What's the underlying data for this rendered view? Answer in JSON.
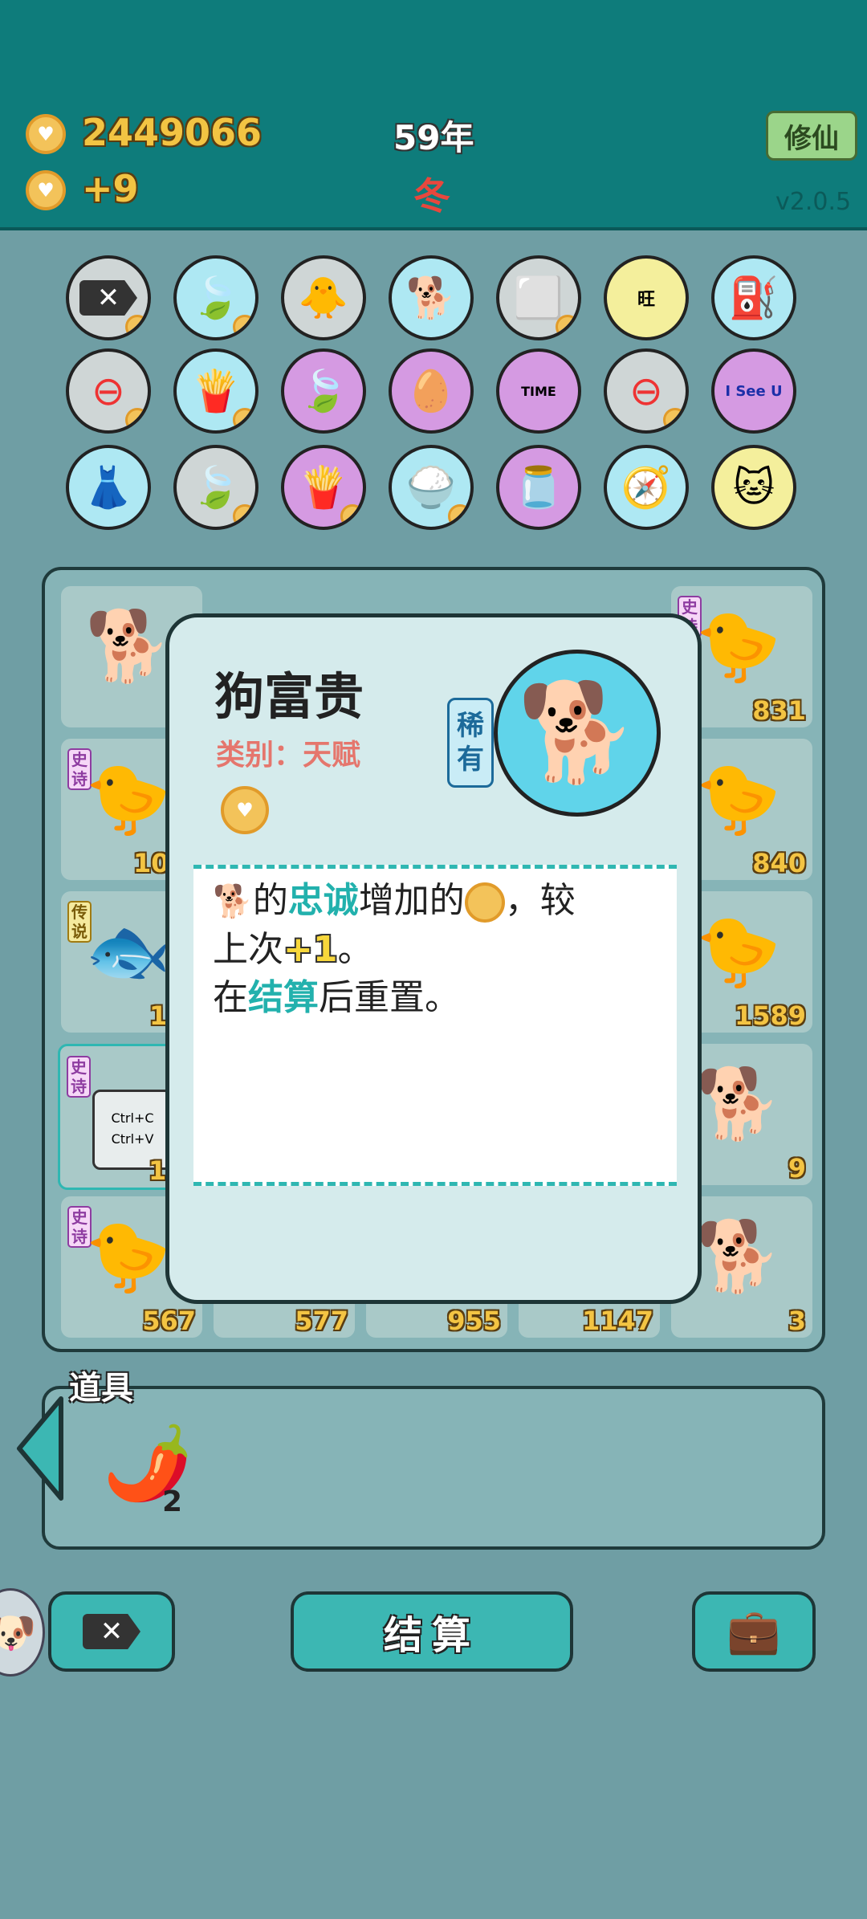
{
  "header": {
    "coins": "2449066",
    "income": "+9",
    "year": "59年",
    "season": "冬",
    "cultivate_label": "修仙",
    "version": "v2.0.5"
  },
  "symbol_icons": [
    [
      "remove-tag-icon",
      "leaf-icon",
      "chick-egg-icon",
      "dog-sunglasses-icon",
      "sugar-cubes-icon",
      "wang-text-icon",
      "pump-icon"
    ],
    [
      "minus-circle-icon",
      "fries-icon",
      "leaf-icon",
      "egg-face-icon",
      "time-magazine-icon",
      "minus-circle-icon",
      "i-see-u-icon"
    ],
    [
      "skirt-icon",
      "leaf-icon",
      "fries-icon",
      "rice-bowl-icon",
      "jar-icon",
      "compass-icon",
      "cat-coins-icon"
    ]
  ],
  "symbol_grid": {
    "wang_char": "旺",
    "time_text": "TIME",
    "isee_text": "I See U"
  },
  "board": {
    "cells": [
      {
        "row": 0,
        "col": 0,
        "value": "",
        "tag": ""
      },
      {
        "row": 0,
        "col": 4,
        "value": "831",
        "tag": "史诗"
      },
      {
        "row": 1,
        "col": 0,
        "value": "10",
        "tag": "史诗"
      },
      {
        "row": 1,
        "col": 4,
        "value": "840",
        "tag": ""
      },
      {
        "row": 2,
        "col": 0,
        "value": "11",
        "tag": "传说"
      },
      {
        "row": 2,
        "col": 4,
        "value": "1589",
        "tag": ""
      },
      {
        "row": 3,
        "col": 0,
        "value": "11",
        "tag": "史诗"
      },
      {
        "row": 3,
        "col": 4,
        "value": "9",
        "tag": ""
      },
      {
        "row": 4,
        "col": 0,
        "value": "567",
        "tag": "史诗"
      },
      {
        "row": 4,
        "col": 1,
        "value": "577",
        "tag": ""
      },
      {
        "row": 4,
        "col": 2,
        "value": "955",
        "tag": ""
      },
      {
        "row": 4,
        "col": 3,
        "value": "1147",
        "tag": ""
      },
      {
        "row": 4,
        "col": 4,
        "value": "3",
        "tag": ""
      }
    ],
    "copy_paste_line1": "Ctrl+C",
    "copy_paste_line2": "Ctrl+V"
  },
  "card": {
    "title": "狗富贵",
    "category": "类别：天赋",
    "rarity_line1": "稀",
    "rarity_line2": "有",
    "desc_part1": "的",
    "desc_kw1": "忠诚",
    "desc_part2": "增加的",
    "desc_part3": "，较",
    "desc_part4": "上次",
    "desc_plus": "+1",
    "desc_part5": "。",
    "desc_part6": "在",
    "desc_kw2": "结算",
    "desc_part7": "后重置。"
  },
  "props": {
    "label": "道具",
    "item_icon": "chili-pepper-icon",
    "item_count": "2"
  },
  "bottom": {
    "settle_label": "结算"
  },
  "colors": {
    "header_bg": "#0e7c7b",
    "accent_teal": "#3cb7b3",
    "coin_gold": "#f3c443",
    "season_red": "#e8473d"
  }
}
